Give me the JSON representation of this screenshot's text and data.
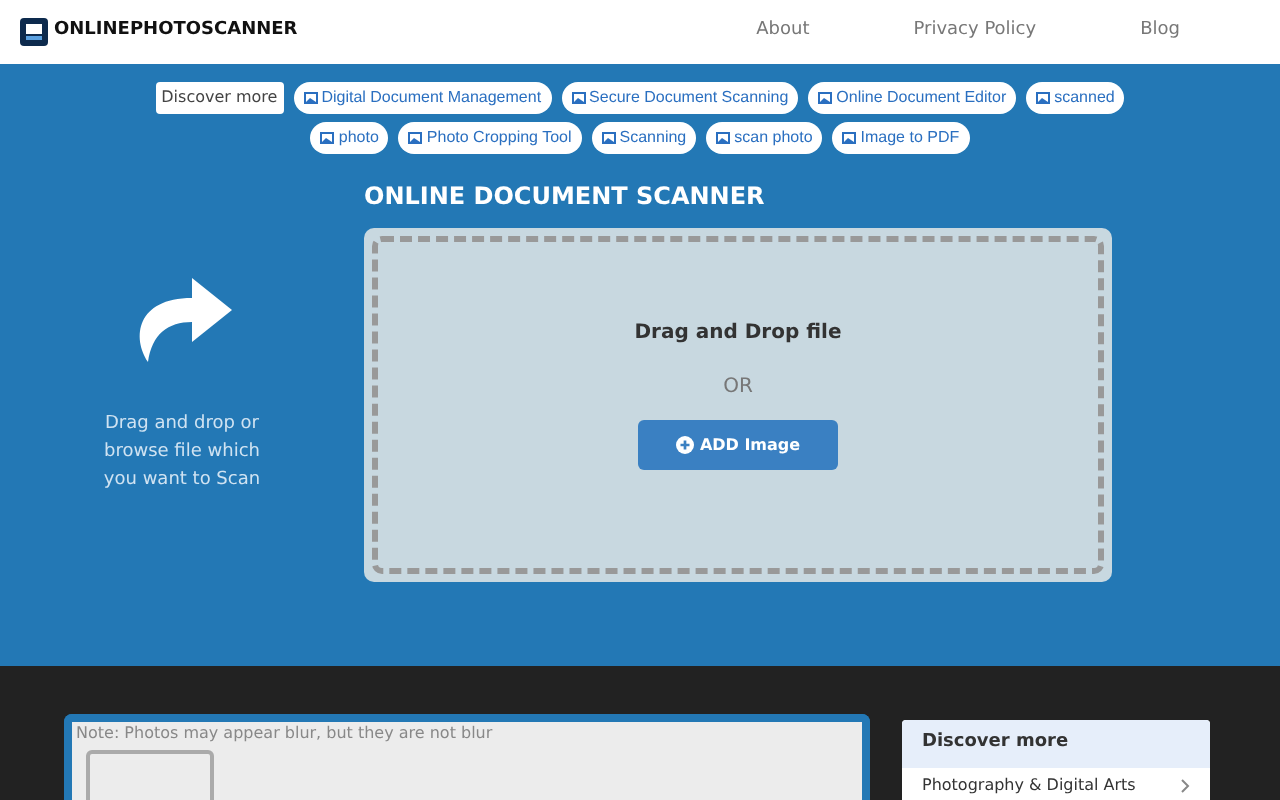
{
  "header": {
    "logo_text": "ONLINEPHOTOSCANNER",
    "nav": [
      "About",
      "Privacy Policy",
      "Blog"
    ]
  },
  "discover": {
    "label": "Discover more",
    "tags": [
      "Digital Document Management",
      "Secure Document Scanning",
      "Online Document Editor",
      "scanned",
      "photo",
      "Photo Cropping Tool",
      "Scanning",
      "scan photo",
      "Image to PDF"
    ]
  },
  "hero": {
    "title": "ONLINE DOCUMENT SCANNER",
    "hint": "Drag and drop or browse file which you want to Scan",
    "drop_title": "Drag and Drop file",
    "or": "OR",
    "button": "ADD Image"
  },
  "preview": {
    "note": "Note: Photos may appear blur, but they are not blur"
  },
  "sidebar": {
    "title": "Discover more",
    "items": [
      "Photography & Digital Arts"
    ]
  }
}
